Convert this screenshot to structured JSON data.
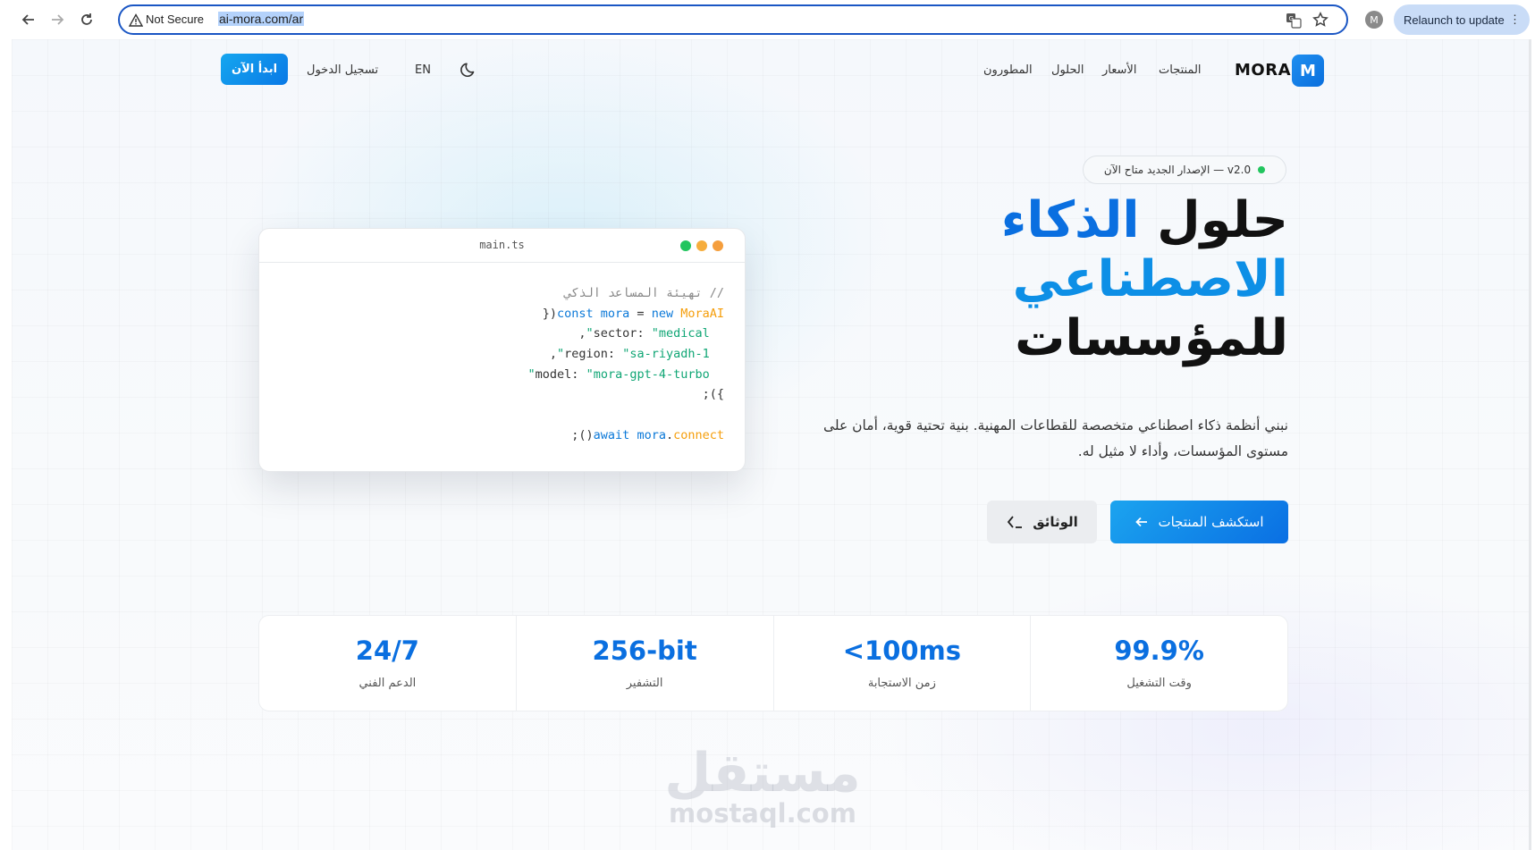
{
  "browser": {
    "security_label": "Not Secure",
    "url": "ai-mora.com/ar",
    "profile_initial": "M",
    "relaunch_label": "Relaunch to update"
  },
  "header": {
    "logo_letter": "M",
    "logo_text": "MORA",
    "nav": [
      "المنتجات",
      "الأسعار",
      "الحلول",
      "المطورون"
    ],
    "lang": "EN",
    "login": "تسجيل الدخول",
    "start": "ابدأ الآن"
  },
  "hero": {
    "badge": "v2.0 — الإصدار الجديد متاح الآن",
    "title_1": "حلول ",
    "title_1_accent": "الذكاء",
    "title_2_accent": "الاصطناعي",
    "title_3": "للمؤسسات",
    "description": "نبني أنظمة ذكاء اصطناعي متخصصة للقطاعات المهنية. بنية تحتية قوية، أمان على مستوى المؤسسات، وأداء لا مثيل له.",
    "explore_button": "استكشف المنتجات",
    "docs_button": "الوثائق"
  },
  "code": {
    "filename": "main.ts",
    "comment": "// تهيئة المساعد الذكي",
    "l2_const": "const",
    "l2_name": "mora",
    "l2_eq": " = ",
    "l2_new": "new",
    "l2_cls": "MoraAI",
    "l2_tail": "({",
    "l3_key": "  sector: ",
    "l3_val": "\"medical\"",
    "l3_tail": ",",
    "l4_key": "  region: ",
    "l4_val": "\"sa-riyadh-1\"",
    "l4_tail": ",",
    "l5_key": "  model: ",
    "l5_val": "\"mora-gpt-4-turbo\"",
    "l6": "});",
    "l8_await": "await",
    "l8_obj": "mora",
    "l8_dot": ".",
    "l8_fn": "connect",
    "l8_tail": "();"
  },
  "stats": [
    {
      "value": "24/7",
      "label": "الدعم الفني"
    },
    {
      "value": "256-bit",
      "label": "التشفير"
    },
    {
      "value": "<100ms",
      "label": "زمن الاستجابة"
    },
    {
      "value": "99.9%",
      "label": "وقت التشغيل"
    }
  ],
  "watermark": {
    "arabic": "مستقل",
    "latin": "mostaql.com"
  }
}
